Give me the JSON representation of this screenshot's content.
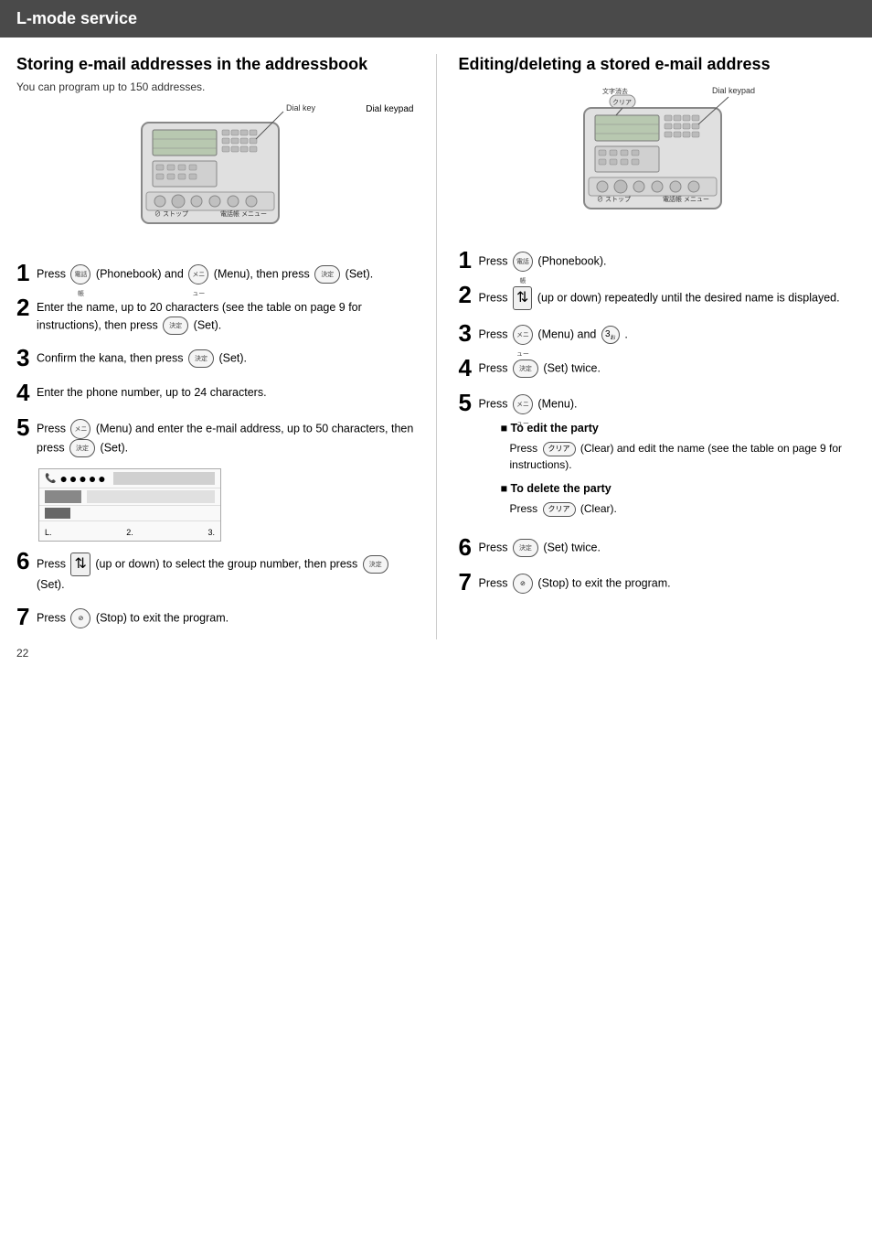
{
  "header": {
    "title": "L-mode service"
  },
  "left": {
    "section_title": "Storing e-mail addresses in the addressbook",
    "subtitle": "You can program up to 150 addresses.",
    "dial_keypad_label": "Dial keypad",
    "steps": [
      {
        "number": "1",
        "text_parts": [
          "Press",
          "(Phonebook) and",
          "(Menu), then press",
          "(Set)."
        ],
        "labels": [
          "電話帳",
          "メニュー",
          "決定"
        ]
      },
      {
        "number": "2",
        "text": "Enter the name, up to 20 characters (see the table on page 9 for instructions), then press",
        "set_label": "(Set).",
        "label": "決定"
      },
      {
        "number": "3",
        "text": "Confirm the kana, then press",
        "set_label": "(Set).",
        "label": "決定"
      },
      {
        "number": "4",
        "text": "Enter the phone number, up to 24 characters."
      },
      {
        "number": "5",
        "text_parts": [
          "Press",
          "(Menu) and enter the e-mail address, up to 50 characters, then press",
          "(Set)."
        ],
        "labels": [
          "メニュー",
          "決定"
        ]
      },
      {
        "number": "6",
        "text_parts": [
          "Press",
          "(up or down) to select the group number, then press",
          "(Set)."
        ],
        "labels": [
          "決定"
        ]
      },
      {
        "number": "7",
        "text_parts": [
          "Press",
          "(Stop) to exit the program."
        ],
        "labels": [
          "ストップ"
        ]
      }
    ],
    "screen": {
      "row1_icon": "📞",
      "row1_dots": "● ● ● ● ●",
      "row1_input": "",
      "highlight_text": "",
      "bottom": [
        "1.",
        "2.",
        "3."
      ]
    }
  },
  "right": {
    "section_title": "Editing/deleting a stored e-mail address",
    "dial_keypad_label": "Dial keypad",
    "steps": [
      {
        "number": "1",
        "text_parts": [
          "Press",
          "(Phonebook)."
        ],
        "labels": [
          "電話帳"
        ]
      },
      {
        "number": "2",
        "text": "Press",
        "arrow": "↑↓",
        "text2": "(up or down) repeatedly until the desired name is displayed."
      },
      {
        "number": "3",
        "text_parts": [
          "Press",
          "(Menu) and",
          "."
        ],
        "labels": [
          "メニュー",
          "3"
        ]
      },
      {
        "number": "4",
        "text_parts": [
          "Press",
          "(Set) twice."
        ],
        "labels": [
          "決定"
        ]
      },
      {
        "number": "5",
        "text_parts": [
          "Press",
          "(Menu)."
        ],
        "labels": [
          "メニュー"
        ]
      },
      {
        "number": "6",
        "text_parts": [
          "Press",
          "(Set) twice."
        ],
        "labels": [
          "決定"
        ]
      },
      {
        "number": "7",
        "text_parts": [
          "Press",
          "(Stop) to exit the program."
        ],
        "labels": [
          "ストップ"
        ]
      }
    ],
    "to_edit": {
      "title": "■ To edit the party",
      "text": "Press",
      "icon_label": "クリア",
      "text2": "(Clear) and edit the name (see the table on page 9 for instructions)."
    },
    "to_delete": {
      "title": "■ To delete the party",
      "text": "Press",
      "icon_label": "クリア",
      "text2": "(Clear)."
    }
  },
  "page_number": "22"
}
